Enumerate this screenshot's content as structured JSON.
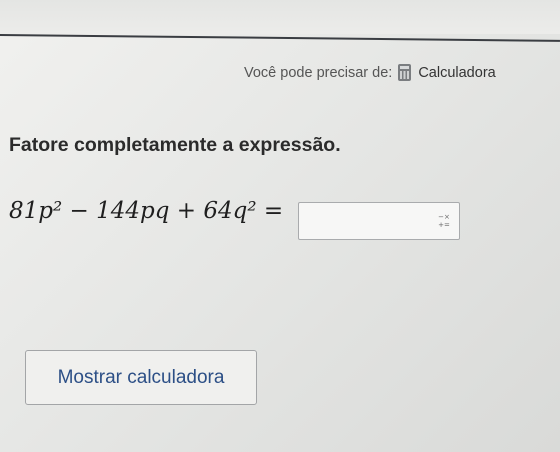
{
  "hint": {
    "text": "Você pode precisar de:",
    "calculator_link": "Calculadora",
    "icon": "calculator-icon"
  },
  "question": {
    "prompt": "Fatore completamente a expressão.",
    "expression": "81p² − 144pq + 64q² =",
    "answer_value": "",
    "keypad_icon": "math-keypad-icon",
    "keypad_glyph_top": "−×",
    "keypad_glyph_bottom": "+="
  },
  "actions": {
    "show_calculator_label": "Mostrar calculadora"
  },
  "colors": {
    "button_text": "#2c4f86",
    "divider": "#3a3d42"
  }
}
